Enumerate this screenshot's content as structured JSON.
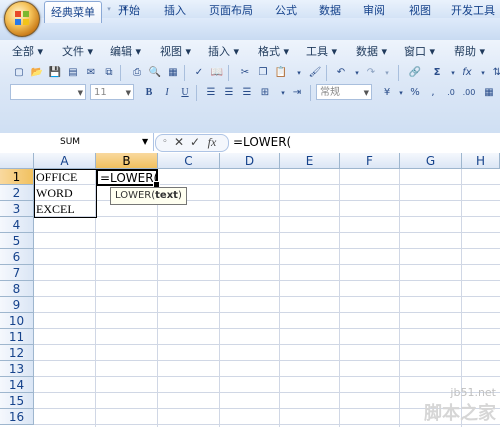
{
  "quick_access": {
    "icons": [
      "save-icon",
      "undo-icon",
      "redo-icon",
      "customize-icon"
    ]
  },
  "tabs": [
    "经典菜单",
    "开始",
    "插入",
    "页面布局",
    "公式",
    "数据",
    "审阅",
    "视图",
    "开发工具"
  ],
  "active_tab": "经典菜单",
  "menus": [
    "全部 ▾",
    "文件 ▾",
    "编辑 ▾",
    "视图 ▾",
    "插入 ▾",
    "格式 ▾",
    "工具 ▾",
    "数据 ▾",
    "窗口 ▾",
    "帮助 ▾"
  ],
  "toolbar": {
    "font_size": "11",
    "style_combo": "常规",
    "bold": "B",
    "italic": "I",
    "underline": "U",
    "sum_symbol": "Σ",
    "fx_symbol": "fx",
    "percent": "%"
  },
  "formula_bar": {
    "name_box": "SUM",
    "cancel": "✕",
    "enter": "✓",
    "fx": "fx",
    "formula": "=LOWER("
  },
  "columns": [
    "A",
    "B",
    "C",
    "D",
    "E",
    "F",
    "G",
    "H"
  ],
  "selected_column": "B",
  "rows": [
    "1",
    "2",
    "3",
    "4",
    "5",
    "6",
    "7",
    "8",
    "9",
    "10",
    "11",
    "12",
    "13",
    "14",
    "15",
    "16"
  ],
  "selected_row": "1",
  "cells": {
    "A1": "OFFICE",
    "A2": "WORD",
    "A3": "EXCEL",
    "B1": "=LOWER("
  },
  "tooltip": {
    "func": "LOWER(",
    "arg": "text",
    "close": ")"
  },
  "watermark": {
    "site": "jb51.net",
    "brand": "脚本之家"
  }
}
